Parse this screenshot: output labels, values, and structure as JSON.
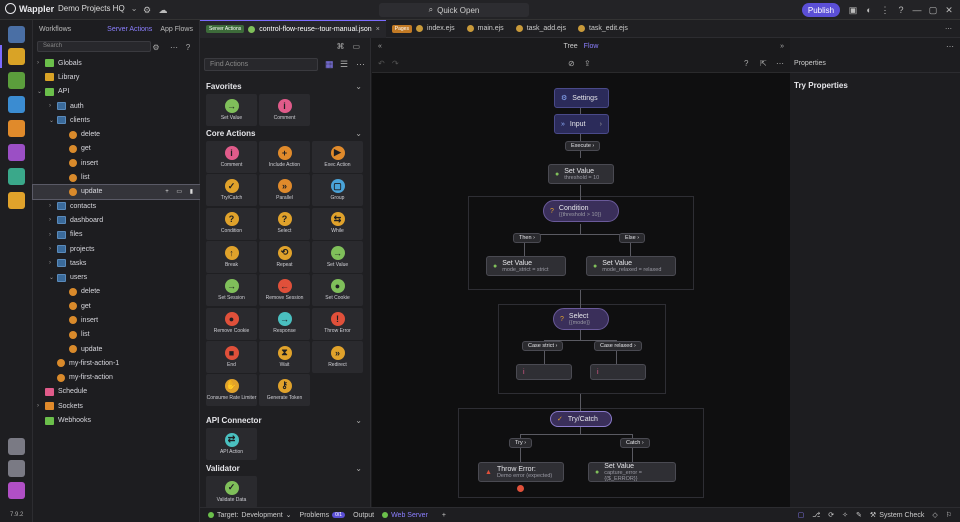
{
  "app": {
    "name": "Wappler",
    "project": "Demo Projects HQ",
    "quick_open": "Quick Open",
    "publish": "Publish",
    "version": "7.9.2"
  },
  "panel": {
    "tabs": {
      "workflows": "Workflows",
      "server_actions": "Server Actions",
      "app_flows": "App Flows"
    },
    "search_placeholder": "Search",
    "tree": [
      {
        "label": "Globals",
        "depth": 0,
        "arrow": "›",
        "icon": "globe"
      },
      {
        "label": "Library",
        "depth": 0,
        "arrow": "",
        "icon": "library"
      },
      {
        "label": "API",
        "depth": 0,
        "arrow": "⌄",
        "icon": "api"
      },
      {
        "label": "auth",
        "depth": 1,
        "arrow": "›",
        "icon": "folder"
      },
      {
        "label": "clients",
        "depth": 1,
        "arrow": "⌄",
        "icon": "folder"
      },
      {
        "label": "delete",
        "depth": 2,
        "arrow": "",
        "icon": "action"
      },
      {
        "label": "get",
        "depth": 2,
        "arrow": "",
        "icon": "action"
      },
      {
        "label": "insert",
        "depth": 2,
        "arrow": "",
        "icon": "action"
      },
      {
        "label": "list",
        "depth": 2,
        "arrow": "",
        "icon": "action"
      },
      {
        "label": "update",
        "depth": 2,
        "arrow": "",
        "icon": "action",
        "selected": true
      },
      {
        "label": "contacts",
        "depth": 1,
        "arrow": "›",
        "icon": "folder"
      },
      {
        "label": "dashboard",
        "depth": 1,
        "arrow": "›",
        "icon": "folder"
      },
      {
        "label": "files",
        "depth": 1,
        "arrow": "›",
        "icon": "folder"
      },
      {
        "label": "projects",
        "depth": 1,
        "arrow": "›",
        "icon": "folder"
      },
      {
        "label": "tasks",
        "depth": 1,
        "arrow": "›",
        "icon": "folder"
      },
      {
        "label": "users",
        "depth": 1,
        "arrow": "⌄",
        "icon": "folder"
      },
      {
        "label": "delete",
        "depth": 2,
        "arrow": "",
        "icon": "action"
      },
      {
        "label": "get",
        "depth": 2,
        "arrow": "",
        "icon": "action"
      },
      {
        "label": "insert",
        "depth": 2,
        "arrow": "",
        "icon": "action"
      },
      {
        "label": "list",
        "depth": 2,
        "arrow": "",
        "icon": "action"
      },
      {
        "label": "update",
        "depth": 2,
        "arrow": "",
        "icon": "action"
      },
      {
        "label": "my-first-action-1",
        "depth": 1,
        "arrow": "",
        "icon": "action"
      },
      {
        "label": "my-first-action",
        "depth": 1,
        "arrow": "",
        "icon": "action"
      },
      {
        "label": "Schedule",
        "depth": 0,
        "arrow": "",
        "icon": "schedule"
      },
      {
        "label": "Sockets",
        "depth": 0,
        "arrow": "›",
        "icon": "sockets"
      },
      {
        "label": "Webhooks",
        "depth": 0,
        "arrow": "",
        "icon": "webhooks"
      }
    ]
  },
  "tabs": [
    {
      "badge": "Server Actions",
      "label": "control-flow-reuse--tour-manual.json",
      "active": true
    },
    {
      "badge": "Pages",
      "label": "index.ejs"
    },
    {
      "label": "main.ejs"
    },
    {
      "label": "task_add.ejs"
    },
    {
      "label": "task_edit.ejs"
    }
  ],
  "actions": {
    "find_placeholder": "Find Actions",
    "favorites_title": "Favorites",
    "favorites": [
      {
        "label": "Set Value",
        "color": "#7fbf5a",
        "glyph": "→"
      },
      {
        "label": "Comment",
        "color": "#e05b8a",
        "glyph": "i"
      }
    ],
    "core_title": "Core Actions",
    "core": [
      {
        "label": "Comment",
        "color": "#e05b8a",
        "glyph": "i"
      },
      {
        "label": "Include Action",
        "color": "#e08a2b",
        "glyph": "+"
      },
      {
        "label": "Exec Action",
        "color": "#e08a2b",
        "glyph": "▶"
      },
      {
        "label": "Try/Catch",
        "color": "#e0a22b",
        "glyph": "✓"
      },
      {
        "label": "Parallel",
        "color": "#e08a2b",
        "glyph": "»"
      },
      {
        "label": "Group",
        "color": "#4aa3d8",
        "glyph": "▢"
      },
      {
        "label": "Condition",
        "color": "#e0a22b",
        "glyph": "?"
      },
      {
        "label": "Select",
        "color": "#e0a22b",
        "glyph": "?"
      },
      {
        "label": "While",
        "color": "#e0a22b",
        "glyph": "⇆"
      },
      {
        "label": "Break",
        "color": "#e0a22b",
        "glyph": "↑"
      },
      {
        "label": "Repeat",
        "color": "#e0a22b",
        "glyph": "⟲"
      },
      {
        "label": "Set Value",
        "color": "#7fbf5a",
        "glyph": "→"
      },
      {
        "label": "Set Session",
        "color": "#7fbf5a",
        "glyph": "→"
      },
      {
        "label": "Remove Session",
        "color": "#e0503a",
        "glyph": "←"
      },
      {
        "label": "Set Cookie",
        "color": "#7fbf5a",
        "glyph": "●"
      },
      {
        "label": "Remove Cookie",
        "color": "#e0503a",
        "glyph": "●"
      },
      {
        "label": "Response",
        "color": "#4ac0c0",
        "glyph": "→"
      },
      {
        "label": "Throw Error",
        "color": "#e0503a",
        "glyph": "!"
      },
      {
        "label": "End",
        "color": "#e0503a",
        "glyph": "■"
      },
      {
        "label": "Wait",
        "color": "#e0a22b",
        "glyph": "⧗"
      },
      {
        "label": "Redirect",
        "color": "#e0a22b",
        "glyph": "»"
      },
      {
        "label": "Consume Rate Limiter",
        "color": "#e0a22b",
        "glyph": "✋"
      },
      {
        "label": "Generate Token",
        "color": "#e0a22b",
        "glyph": "⚷"
      }
    ],
    "api_title": "API Connector",
    "api": [
      {
        "label": "API Action",
        "color": "#4ac0c0",
        "glyph": "⇄"
      }
    ],
    "validator_title": "Validator",
    "validator": [
      {
        "label": "Validate Data",
        "color": "#7fbf5a",
        "glyph": "✓"
      }
    ]
  },
  "canvas": {
    "view_tree": "Tree",
    "view_flow": "Flow",
    "settings": "Settings",
    "input": "Input",
    "execute": "Execute",
    "set_value_1": {
      "title": "Set Value",
      "sub": "threshold = 10"
    },
    "condition": {
      "title": "Condition",
      "sub": "{{threshold > 10}}"
    },
    "then": "Then",
    "else": "Else",
    "set_value_strict": {
      "title": "Set Value",
      "sub": "mode_strict = strict"
    },
    "set_value_relaxed": {
      "title": "Set Value",
      "sub": "mode_relaxed = relaxed"
    },
    "select": {
      "title": "Select",
      "sub": "{{mode}}"
    },
    "case_strict": "Case strict",
    "case_relaxed": "Case relaxed",
    "trycatch": "Try/Catch",
    "try": "Try",
    "catch": "Catch",
    "throw_error": {
      "title": "Throw Error:",
      "sub": "Demo error (expected)"
    },
    "set_value_catch": {
      "title": "Set Value",
      "sub": "capture_error = {{$_ERROR}}"
    }
  },
  "properties": {
    "header": "Properties",
    "title": "Try Properties"
  },
  "status": {
    "target_label": "Target:",
    "target": "Development",
    "problems": "Problems",
    "problems_count": "0/1",
    "output": "Output",
    "web_server": "Web Server",
    "system_check": "System Check"
  },
  "colors": {
    "accent": "#7b6bff",
    "publish": "#5b4fd6"
  }
}
